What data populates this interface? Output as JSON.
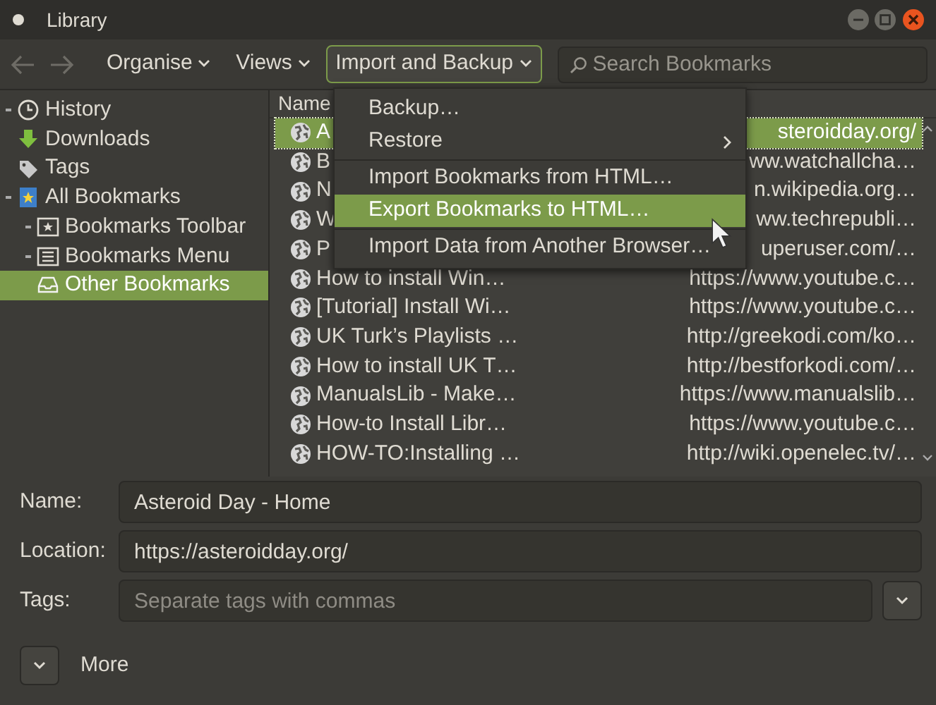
{
  "window": {
    "title": "Library"
  },
  "toolbar": {
    "back_disabled": true,
    "menus": [
      {
        "label": "Organise",
        "selected": false
      },
      {
        "label": "Views",
        "selected": false
      },
      {
        "label": "Import and Backup",
        "selected": true
      }
    ],
    "search": {
      "placeholder": "Search Bookmarks"
    }
  },
  "sidebar": {
    "items": [
      {
        "label": "History",
        "kind": "history",
        "selected": false
      },
      {
        "label": "Downloads",
        "kind": "downloads",
        "selected": false
      },
      {
        "label": "Tags",
        "kind": "tags",
        "selected": false
      },
      {
        "label": "All Bookmarks",
        "kind": "all",
        "selected": false,
        "children": [
          {
            "label": "Bookmarks Toolbar",
            "kind": "toolbar",
            "selected": false
          },
          {
            "label": "Bookmarks Menu",
            "kind": "menu",
            "selected": false
          },
          {
            "label": "Other Bookmarks",
            "kind": "other",
            "selected": true
          }
        ]
      }
    ]
  },
  "table": {
    "columns": [
      "Name"
    ],
    "rows": [
      {
        "name": "A",
        "location": "steroidday.org/",
        "selected": true
      },
      {
        "name": "B",
        "location": "ww.watchallcha…",
        "selected": false
      },
      {
        "name": "N",
        "location": "n.wikipedia.org…",
        "selected": false
      },
      {
        "name": "W",
        "location": "ww.techrepubli…",
        "selected": false
      },
      {
        "name": "P",
        "location": "uperuser.com/…",
        "selected": false
      },
      {
        "name": "How to install Win…",
        "location": "https://www.youtube.c…",
        "selected": false
      },
      {
        "name": "[Tutorial] Install Wi…",
        "location": "https://www.youtube.c…",
        "selected": false
      },
      {
        "name": "UK Turk’s Playlists …",
        "location": "http://greekodi.com/ko…",
        "selected": false
      },
      {
        "name": "How to install UK T…",
        "location": "http://bestforkodi.com/…",
        "selected": false
      },
      {
        "name": "ManualsLib - Make…",
        "location": "https://www.manualslib…",
        "selected": false
      },
      {
        "name": "How-to Install Libr…",
        "location": "https://www.youtube.c…",
        "selected": false
      },
      {
        "name": "HOW-TO:Installing …",
        "location": "http://wiki.openelec.tv/…",
        "selected": false
      }
    ]
  },
  "menu": {
    "items": [
      {
        "kind": "item",
        "label": "Backup…",
        "selected": false
      },
      {
        "kind": "submenu",
        "label": "Restore",
        "selected": false
      },
      {
        "kind": "separator"
      },
      {
        "kind": "item",
        "label": "Import Bookmarks from HTML…",
        "selected": false
      },
      {
        "kind": "item",
        "label": "Export Bookmarks to HTML…",
        "selected": true
      },
      {
        "kind": "separator"
      },
      {
        "kind": "item",
        "label": "Import Data from Another Browser…",
        "selected": false
      }
    ]
  },
  "details": {
    "name": {
      "label": "Name:",
      "value": "Asteroid Day - Home"
    },
    "location": {
      "label": "Location:",
      "value": "https://asteroidday.org/"
    },
    "tags": {
      "label": "Tags:",
      "placeholder": "Separate tags with commas"
    },
    "more": {
      "label": "More",
      "expanded": false
    }
  }
}
